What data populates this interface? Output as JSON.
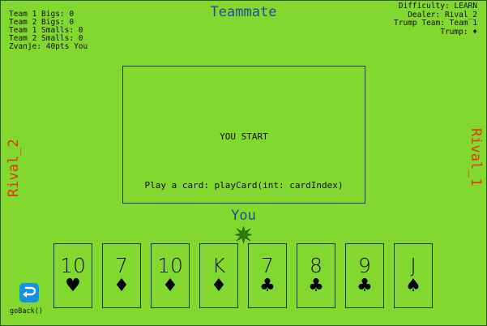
{
  "stats": {
    "team1_bigs": "Team 1 Bigs: 0",
    "team2_bigs": "Team 2 Bigs: 0",
    "team1_smalls": "Team 1 Smalls: 0",
    "team2_smalls": "Team 2 Smalls: 0",
    "zvanje": "Zvanje: 40pts You"
  },
  "info": {
    "difficulty": "Difficulty: LEARN",
    "dealer": "Dealer: Rival_2",
    "trump_team": "Trump Team: Team 1",
    "trump": "Trump: ♦"
  },
  "players": {
    "teammate": "Teammate",
    "you": "You",
    "rival_left": "Rival_2",
    "rival_right": "Rival_1"
  },
  "table": {
    "message": "YOU START",
    "hint": "Play a card: playCard(int: cardIndex)"
  },
  "hand": [
    {
      "rank": "10",
      "suit": "♥"
    },
    {
      "rank": "7",
      "suit": "♦"
    },
    {
      "rank": "10",
      "suit": "♦"
    },
    {
      "rank": "K",
      "suit": "♦"
    },
    {
      "rank": "7",
      "suit": "♣"
    },
    {
      "rank": "8",
      "suit": "♣"
    },
    {
      "rank": "9",
      "suit": "♣"
    },
    {
      "rank": "J",
      "suit": "♠"
    }
  ],
  "controls": {
    "back_label": "goBack()",
    "back_icon": "return-arrow-icon",
    "turn_icon": "turn-indicator-star-icon"
  },
  "colors": {
    "background": "#82d82e",
    "player_name": "#1d4b9c",
    "rival_name": "#d93a12",
    "back_button": "#1690e6",
    "turn_star": "#2e7d12"
  }
}
